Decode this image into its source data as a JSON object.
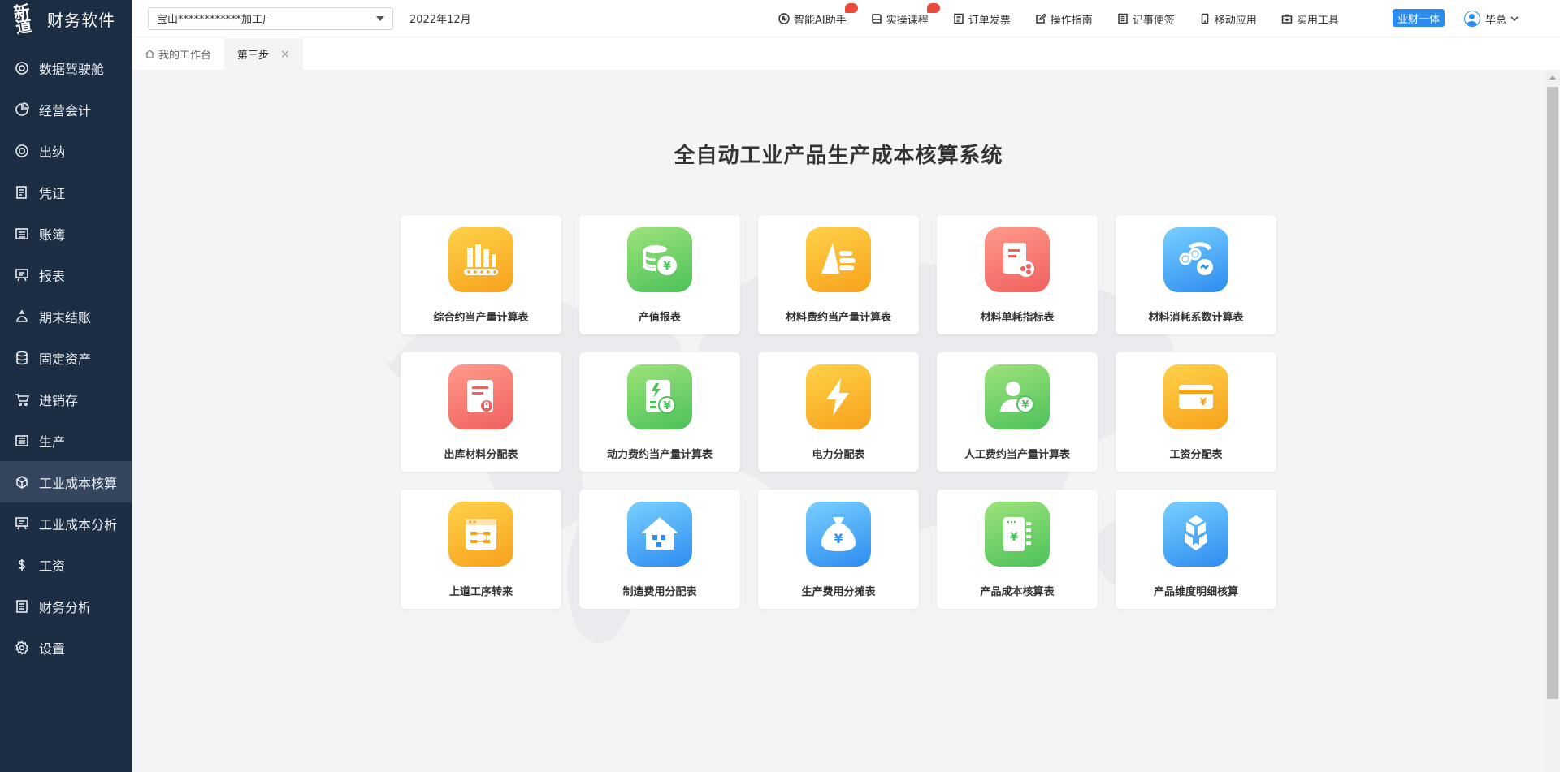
{
  "sidebar": {
    "logo_mark": "新道",
    "logo_text": "财务软件",
    "items": [
      {
        "label": "数据驾驶舱",
        "icon": "dashboard-icon"
      },
      {
        "label": "经营会计",
        "icon": "pie-icon"
      },
      {
        "label": "出纳",
        "icon": "cashier-icon"
      },
      {
        "label": "凭证",
        "icon": "voucher-icon"
      },
      {
        "label": "账簿",
        "icon": "ledger-icon"
      },
      {
        "label": "报表",
        "icon": "report-icon"
      },
      {
        "label": "期末结账",
        "icon": "closing-icon"
      },
      {
        "label": "固定资产",
        "icon": "database-icon"
      },
      {
        "label": "进销存",
        "icon": "cart-icon"
      },
      {
        "label": "生产",
        "icon": "production-icon"
      },
      {
        "label": "工业成本核算",
        "icon": "cube-icon",
        "active": true
      },
      {
        "label": "工业成本分析",
        "icon": "report-icon"
      },
      {
        "label": "工资",
        "icon": "dollar-icon"
      },
      {
        "label": "财务分析",
        "icon": "analysis-icon"
      },
      {
        "label": "设置",
        "icon": "gear-icon"
      }
    ]
  },
  "topbar": {
    "company": "宝山************加工厂",
    "period": "2022年12月",
    "links": [
      {
        "label": "智能AI助手",
        "icon": "ai-icon",
        "hot": true
      },
      {
        "label": "实操课程",
        "icon": "book-icon",
        "hot": true
      },
      {
        "label": "订单发票",
        "icon": "invoice-icon"
      },
      {
        "label": "操作指南",
        "icon": "edit-icon"
      },
      {
        "label": "记事便签",
        "icon": "note-icon"
      },
      {
        "label": "移动应用",
        "icon": "mobile-icon"
      },
      {
        "label": "实用工具",
        "icon": "toolbox-icon"
      }
    ],
    "yecai_label": "业财一体",
    "user_name": "毕总"
  },
  "tabs": {
    "home_label": "我的工作台",
    "current_label": "第三步",
    "close_glyph": "×"
  },
  "main": {
    "title": "全自动工业产品生产成本核算系统",
    "cards": [
      {
        "label": "综合约当产量计算表",
        "icon": "bar-chart-icon",
        "color": "#f7a11c"
      },
      {
        "label": "产值报表",
        "icon": "coin-stack-icon",
        "color": "#4cc15a"
      },
      {
        "label": "材料费约当产量计算表",
        "icon": "triangle-bars-icon",
        "color": "#f7a11c"
      },
      {
        "label": "材料单耗指标表",
        "icon": "document-chart-icon",
        "color": "#f0605e"
      },
      {
        "label": "材料消耗系数计算表",
        "icon": "gears-icon",
        "color": "#2d8cf0"
      },
      {
        "label": "出库材料分配表",
        "icon": "document-lock-icon",
        "color": "#f0605e"
      },
      {
        "label": "动力费约当产量计算表",
        "icon": "power-fee-icon",
        "color": "#4cc15a"
      },
      {
        "label": "电力分配表",
        "icon": "lightning-icon",
        "color": "#f7a11c"
      },
      {
        "label": "人工费约当产量计算表",
        "icon": "person-yen-icon",
        "color": "#4cc15a"
      },
      {
        "label": "工资分配表",
        "icon": "card-yen-icon",
        "color": "#f7a11c"
      },
      {
        "label": "上道工序转来",
        "icon": "flow-icon",
        "color": "#f7a11c"
      },
      {
        "label": "制造费用分配表",
        "icon": "house-icon",
        "color": "#2d8cf0"
      },
      {
        "label": "生产费用分摊表",
        "icon": "money-bag-icon",
        "color": "#2d8cf0"
      },
      {
        "label": "产品成本核算表",
        "icon": "calculator-yen-icon",
        "color": "#4cc15a"
      },
      {
        "label": "产品维度明细核算",
        "icon": "cubes-icon",
        "color": "#2d8cf0"
      }
    ]
  }
}
